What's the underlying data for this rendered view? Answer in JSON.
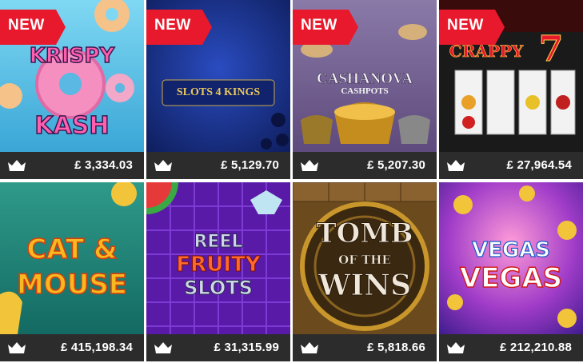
{
  "badge_new": "NEW",
  "games": [
    {
      "title_line1": "KRISPY",
      "title_line2": "KASH",
      "jackpot": "£ 3,334.03",
      "icon": "crown-icon"
    },
    {
      "title_line1": "SLOTS 4 KINGS",
      "jackpot": "£ 5,129.70",
      "icon": "crown-icon"
    },
    {
      "title_line1": "CASHANOVA",
      "title_line2": "CASHPOTS",
      "jackpot": "£ 5,207.30",
      "icon": "crown-icon"
    },
    {
      "title_line1": "CRAPPY",
      "title_line2": "7",
      "jackpot": "£ 27,964.54",
      "icon": "crown-icon"
    },
    {
      "title_line1": "CAT &",
      "title_line2": "MOUSE",
      "jackpot": "£ 415,198.34",
      "icon": "crown-icon"
    },
    {
      "title_line1": "REEL",
      "title_line2": "FRUITY",
      "title_line3": "SLOTS",
      "jackpot": "£ 31,315.99",
      "icon": "crown-icon"
    },
    {
      "title_line1": "TOMB",
      "title_line2": "OF THE",
      "title_line3": "WINS",
      "jackpot": "£ 5,818.66",
      "icon": "crown-icon"
    },
    {
      "title_line1": "VEGAS",
      "title_line2": "VEGAS",
      "jackpot": "£ 212,210.88",
      "icon": "crown-icon"
    }
  ]
}
